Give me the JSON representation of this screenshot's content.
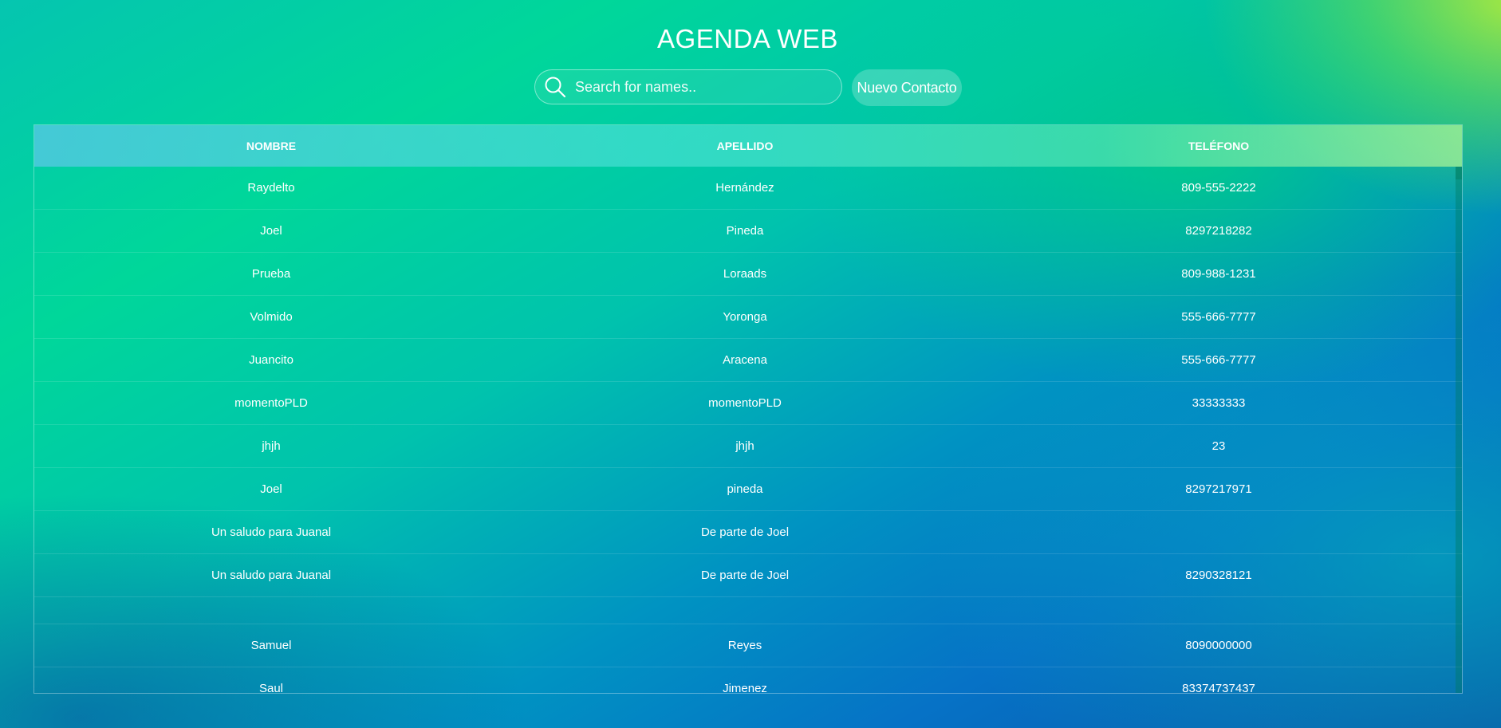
{
  "page": {
    "title": "AGENDA WEB"
  },
  "search": {
    "placeholder": "Search for names.."
  },
  "toolbar": {
    "new_contact_label": "Nuevo Contacto"
  },
  "table": {
    "headers": [
      "NOMBRE",
      "APELLIDO",
      "TELÉFONO"
    ],
    "rows": [
      [
        "Raydelto",
        "Hernández",
        "809-555-2222"
      ],
      [
        "Joel",
        "Pineda",
        "8297218282"
      ],
      [
        "Prueba",
        "Loraads",
        "809-988-1231"
      ],
      [
        "Volmido",
        "Yoronga",
        "555-666-7777"
      ],
      [
        "Juancito",
        "Aracena",
        "555-666-7777"
      ],
      [
        "momentoPLD",
        "momentoPLD",
        "33333333"
      ],
      [
        "jhjh",
        "jhjh",
        "23"
      ],
      [
        "Joel",
        "pineda",
        "8297217971"
      ],
      [
        "Un saludo para Juanal",
        "De parte de Joel",
        ""
      ],
      [
        "Un saludo para Juanal",
        "De parte de Joel",
        "8290328121"
      ],
      [
        "",
        "",
        ""
      ],
      [
        "Samuel",
        "Reyes",
        "8090000000"
      ],
      [
        "Saul",
        "Jimenez",
        "83374737437"
      ]
    ]
  }
}
